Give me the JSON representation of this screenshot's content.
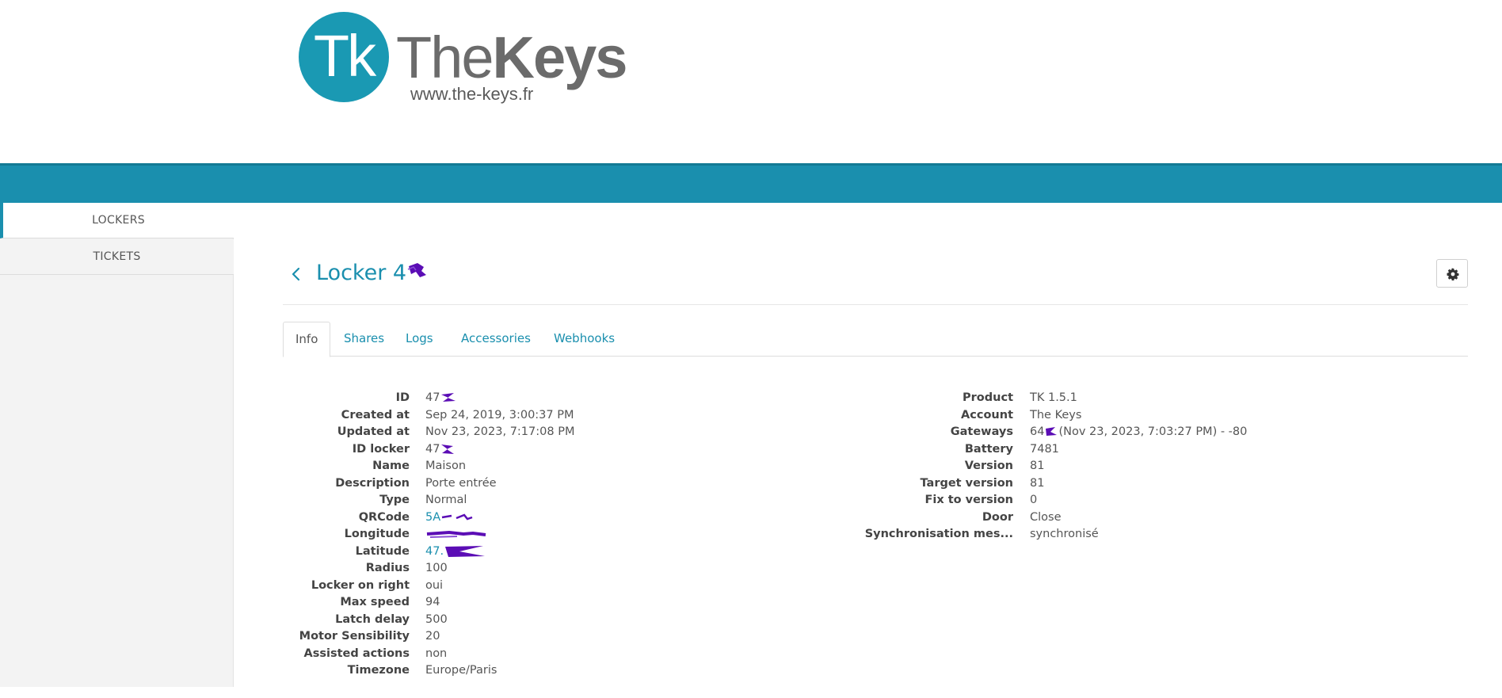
{
  "brand": {
    "logo_monogram": "Tk",
    "logo_name_the": "The",
    "logo_name_keys": "Keys",
    "logo_url": "www.the-keys.fr",
    "accent_color": "#1a8fae"
  },
  "sidebar": {
    "items": [
      {
        "label": "LOCKERS",
        "active": true
      },
      {
        "label": "TICKETS",
        "active": false
      }
    ]
  },
  "page": {
    "title_prefix": "Locker 4",
    "back_icon": "chevron-left-icon",
    "settings_icon": "gear-icon"
  },
  "tabs": [
    {
      "label": "Info",
      "active": true
    },
    {
      "label": "Shares",
      "active": false
    },
    {
      "label": "Logs",
      "active": false
    },
    {
      "label": "Accessories",
      "active": false
    },
    {
      "label": "Webhooks",
      "active": false
    }
  ],
  "info_left": [
    {
      "label": "ID",
      "value": "47"
    },
    {
      "label": "Created at",
      "value": "Sep 24, 2019, 3:00:37 PM"
    },
    {
      "label": "Updated at",
      "value": "Nov 23, 2023, 7:17:08 PM"
    },
    {
      "label": "ID locker",
      "value": "47"
    },
    {
      "label": "Name",
      "value": "Maison"
    },
    {
      "label": "Description",
      "value": "Porte entrée"
    },
    {
      "label": "Type",
      "value": "Normal"
    },
    {
      "label": "QRCode",
      "value": "5A"
    },
    {
      "label": "Longitude",
      "value": ""
    },
    {
      "label": "Latitude",
      "value": "47."
    },
    {
      "label": "Radius",
      "value": "100"
    },
    {
      "label": "Locker on right",
      "value": "oui"
    },
    {
      "label": "Max speed",
      "value": "94"
    },
    {
      "label": "Latch delay",
      "value": "500"
    },
    {
      "label": "Motor Sensibility",
      "value": "20"
    },
    {
      "label": "Assisted actions",
      "value": "non"
    },
    {
      "label": "Timezone",
      "value": "Europe/Paris"
    }
  ],
  "info_right": [
    {
      "label": "Product",
      "value": "TK 1.5.1"
    },
    {
      "label": "Account",
      "value": "The Keys"
    },
    {
      "label": "Gateways",
      "value": "64",
      "value_suffix": "(Nov 23, 2023, 7:03:27 PM) - -80"
    },
    {
      "label": "Battery",
      "value": "7481"
    },
    {
      "label": "Version",
      "value": "81"
    },
    {
      "label": "Target version",
      "value": "81"
    },
    {
      "label": "Fix to version",
      "value": "0"
    },
    {
      "label": "Door",
      "value": "Close"
    },
    {
      "label": "Synchronisation mes...",
      "value": "synchronisé"
    }
  ]
}
